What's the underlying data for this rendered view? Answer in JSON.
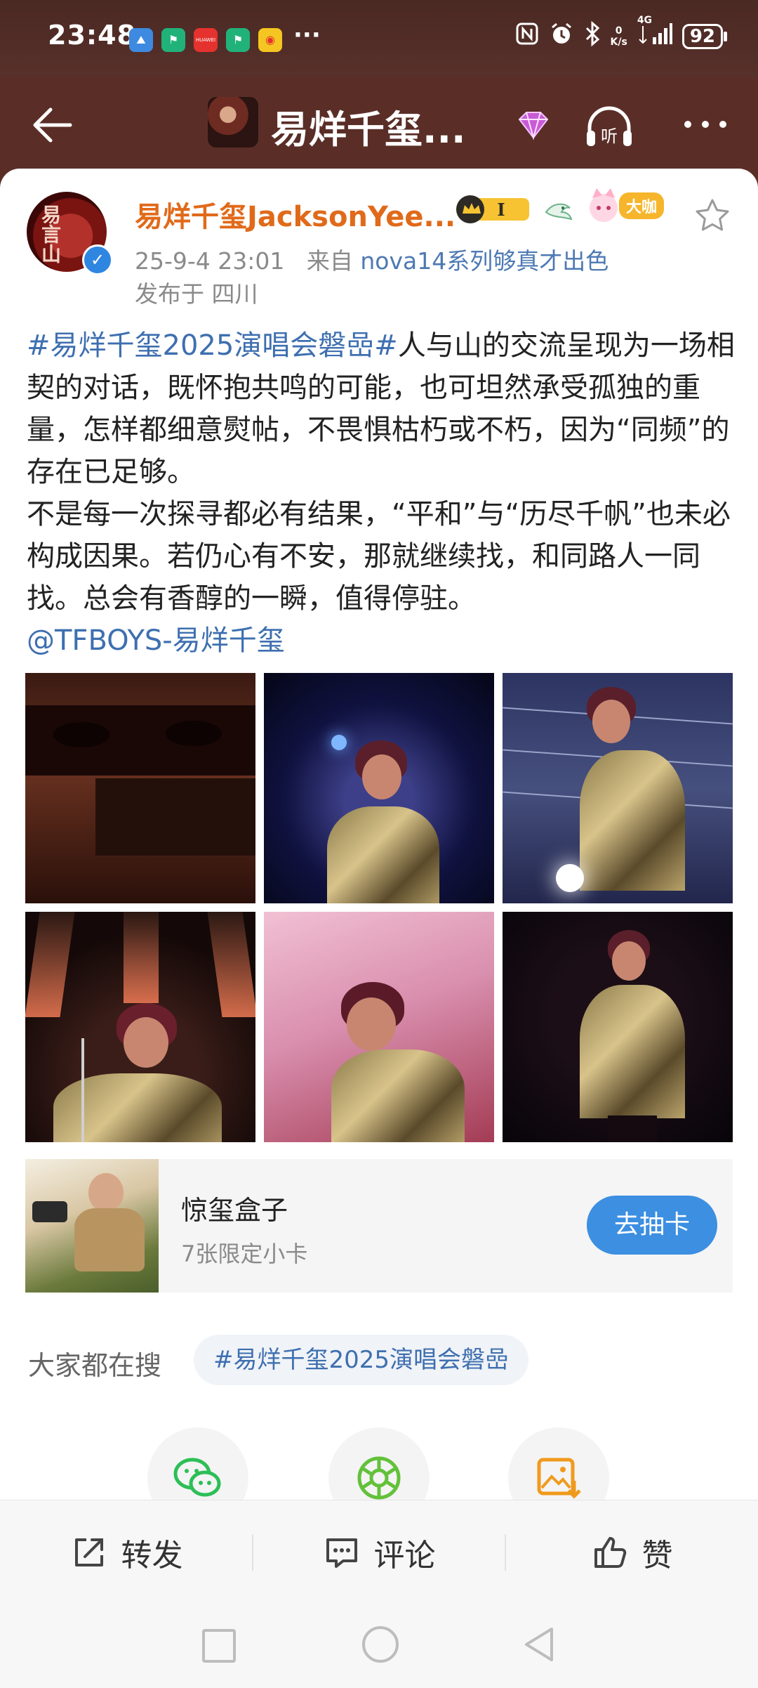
{
  "status_bar": {
    "time": "23:48",
    "ellipsis": "···",
    "net_speed_top": "0",
    "net_speed_unit": "K/s",
    "network": "4G",
    "battery": "92",
    "mini_app_label": "HUAWEI"
  },
  "top_nav": {
    "title": "易烊千玺..."
  },
  "post": {
    "author_name": "易烊千玺JacksonYee...",
    "avatar_text": "易言山",
    "level_badge": "I",
    "vip_badge": "大咖",
    "timestamp": "25-9-4 23:01",
    "source_prefix": "来自",
    "source": "nova14系列够真才出色",
    "location": "发布于 四川",
    "topic": "#易烊千玺2025演唱会磐嵒#",
    "text_1": "人与山的交流呈现为一场相契的对话，既怀抱共鸣的可能，也可坦然承受孤独的重量，怎样都细意熨帖，不畏惧枯朽或不朽，因为“同频”的存在已足够。",
    "text_2": "不是每一次探寻都必有结果，“平和”与“历尽千帆”也未必构成因果。若仍心有不安，那就继续找，和同路人一同找。总会有香醇的一瞬，值得停驻。",
    "mention": "@TFBOYS-易烊千玺"
  },
  "promo": {
    "title": "惊玺盒子",
    "subtitle": "7张限定小卡",
    "button_label": "去抽卡"
  },
  "trend": {
    "label": "大家都在搜",
    "tag": "#易烊千玺2025演唱会磐嵒"
  },
  "share_icons": [
    "wechat-icon",
    "moments-icon",
    "save-image-icon"
  ],
  "action_bar": {
    "repost_label": "转发",
    "comment_label": "评论",
    "like_label": "赞"
  },
  "colors": {
    "header_bg": "#57302a",
    "author_name": "#e06a1a",
    "link": "#3e6fb0",
    "primary_button": "#3c8fe1"
  }
}
